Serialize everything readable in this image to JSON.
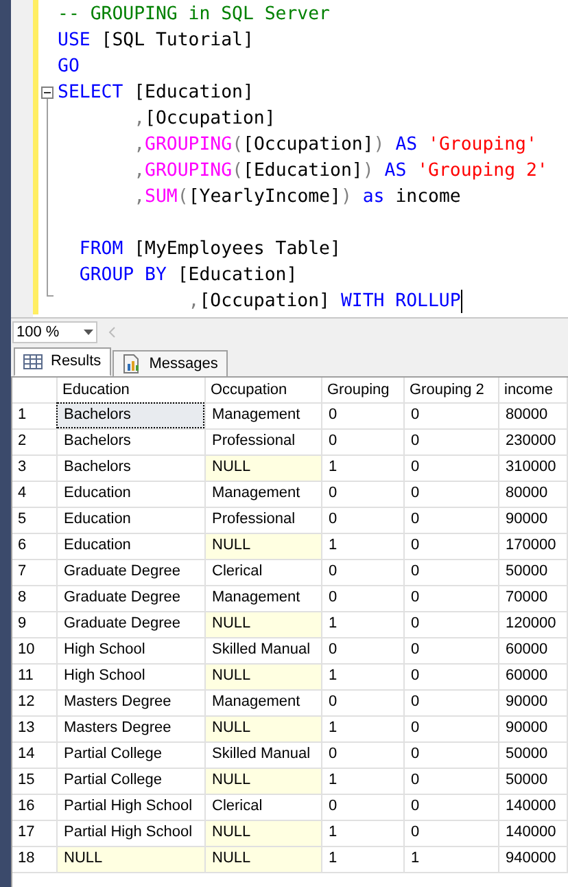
{
  "editor": {
    "lines": [
      {
        "tokens": [
          {
            "kind": "comment",
            "text": "-- GROUPING in SQL Server"
          }
        ]
      },
      {
        "tokens": [
          {
            "kind": "keyword",
            "text": "USE"
          },
          {
            "kind": "plain",
            "text": " [SQL Tutorial]"
          }
        ]
      },
      {
        "tokens": [
          {
            "kind": "keyword",
            "text": "GO"
          }
        ]
      },
      {
        "collapse": true,
        "tokens": [
          {
            "kind": "keyword",
            "text": "SELECT"
          },
          {
            "kind": "plain",
            "text": " [Education]"
          }
        ]
      },
      {
        "tokens": [
          {
            "kind": "operator",
            "text": "       ,"
          },
          {
            "kind": "plain",
            "text": "[Occupation]"
          }
        ]
      },
      {
        "lead": "       ,",
        "tokens": [
          {
            "kind": "function",
            "text": "GROUPING"
          },
          {
            "kind": "operator",
            "text": "("
          },
          {
            "kind": "plain",
            "text": "[Occupation]"
          },
          {
            "kind": "operator",
            "text": ")"
          },
          {
            "kind": "keyword",
            "text": " AS"
          },
          {
            "kind": "string",
            "text": " 'Grouping'"
          }
        ]
      },
      {
        "lead": "       ,",
        "tokens": [
          {
            "kind": "function",
            "text": "GROUPING"
          },
          {
            "kind": "operator",
            "text": "("
          },
          {
            "kind": "plain",
            "text": "[Education]"
          },
          {
            "kind": "operator",
            "text": ")"
          },
          {
            "kind": "keyword",
            "text": " AS"
          },
          {
            "kind": "string",
            "text": " 'Grouping 2'"
          }
        ]
      },
      {
        "tokens": [
          {
            "kind": "operator",
            "text": "       ,"
          },
          {
            "kind": "function",
            "text": "SUM"
          },
          {
            "kind": "operator",
            "text": "("
          },
          {
            "kind": "plain",
            "text": "[YearlyIncome]"
          },
          {
            "kind": "operator",
            "text": ")"
          },
          {
            "kind": "keyword",
            "text": " as"
          },
          {
            "kind": "plain",
            "text": " income"
          }
        ]
      },
      {
        "blank_before": true,
        "tokens": [
          {
            "kind": "keyword",
            "text": "  FROM"
          },
          {
            "kind": "plain",
            "text": " [MyEmployees Table]"
          }
        ]
      },
      {
        "tokens": [
          {
            "kind": "keyword",
            "text": "  GROUP BY"
          },
          {
            "kind": "plain",
            "text": " [Education]"
          }
        ]
      },
      {
        "cursor": true,
        "tokens": [
          {
            "kind": "operator",
            "text": "            ,"
          },
          {
            "kind": "plain",
            "text": "[Occupation]"
          },
          {
            "kind": "keyword",
            "text": " WITH ROLLUP"
          }
        ]
      }
    ]
  },
  "zoom": {
    "value": "100 %"
  },
  "tabs": [
    {
      "label": "Results",
      "selected": true
    },
    {
      "label": "Messages",
      "selected": false
    }
  ],
  "table": {
    "columns": [
      "Education",
      "Occupation",
      "Grouping",
      "Grouping 2",
      "income"
    ],
    "rows": [
      {
        "number": "1",
        "cells": [
          {
            "text": "Bachelors",
            "null": false,
            "selected": true
          },
          {
            "text": "Management",
            "null": false,
            "selected": false
          },
          {
            "text": "0",
            "null": false,
            "selected": false
          },
          {
            "text": "0",
            "null": false,
            "selected": false
          },
          {
            "text": "80000",
            "null": false,
            "selected": false
          }
        ]
      },
      {
        "number": "2",
        "cells": [
          {
            "text": "Bachelors",
            "null": false,
            "selected": false
          },
          {
            "text": "Professional",
            "null": false,
            "selected": false
          },
          {
            "text": "0",
            "null": false,
            "selected": false
          },
          {
            "text": "0",
            "null": false,
            "selected": false
          },
          {
            "text": "230000",
            "null": false,
            "selected": false
          }
        ]
      },
      {
        "number": "3",
        "cells": [
          {
            "text": "Bachelors",
            "null": false,
            "selected": false
          },
          {
            "text": "NULL",
            "null": true,
            "selected": false
          },
          {
            "text": "1",
            "null": false,
            "selected": false
          },
          {
            "text": "0",
            "null": false,
            "selected": false
          },
          {
            "text": "310000",
            "null": false,
            "selected": false
          }
        ]
      },
      {
        "number": "4",
        "cells": [
          {
            "text": "Education",
            "null": false,
            "selected": false
          },
          {
            "text": "Management",
            "null": false,
            "selected": false
          },
          {
            "text": "0",
            "null": false,
            "selected": false
          },
          {
            "text": "0",
            "null": false,
            "selected": false
          },
          {
            "text": "80000",
            "null": false,
            "selected": false
          }
        ]
      },
      {
        "number": "5",
        "cells": [
          {
            "text": "Education",
            "null": false,
            "selected": false
          },
          {
            "text": "Professional",
            "null": false,
            "selected": false
          },
          {
            "text": "0",
            "null": false,
            "selected": false
          },
          {
            "text": "0",
            "null": false,
            "selected": false
          },
          {
            "text": "90000",
            "null": false,
            "selected": false
          }
        ]
      },
      {
        "number": "6",
        "cells": [
          {
            "text": "Education",
            "null": false,
            "selected": false
          },
          {
            "text": "NULL",
            "null": true,
            "selected": false
          },
          {
            "text": "1",
            "null": false,
            "selected": false
          },
          {
            "text": "0",
            "null": false,
            "selected": false
          },
          {
            "text": "170000",
            "null": false,
            "selected": false
          }
        ]
      },
      {
        "number": "7",
        "cells": [
          {
            "text": "Graduate Degree",
            "null": false,
            "selected": false
          },
          {
            "text": "Clerical",
            "null": false,
            "selected": false
          },
          {
            "text": "0",
            "null": false,
            "selected": false
          },
          {
            "text": "0",
            "null": false,
            "selected": false
          },
          {
            "text": "50000",
            "null": false,
            "selected": false
          }
        ]
      },
      {
        "number": "8",
        "cells": [
          {
            "text": "Graduate Degree",
            "null": false,
            "selected": false
          },
          {
            "text": "Management",
            "null": false,
            "selected": false
          },
          {
            "text": "0",
            "null": false,
            "selected": false
          },
          {
            "text": "0",
            "null": false,
            "selected": false
          },
          {
            "text": "70000",
            "null": false,
            "selected": false
          }
        ]
      },
      {
        "number": "9",
        "cells": [
          {
            "text": "Graduate Degree",
            "null": false,
            "selected": false
          },
          {
            "text": "NULL",
            "null": true,
            "selected": false
          },
          {
            "text": "1",
            "null": false,
            "selected": false
          },
          {
            "text": "0",
            "null": false,
            "selected": false
          },
          {
            "text": "120000",
            "null": false,
            "selected": false
          }
        ]
      },
      {
        "number": "10",
        "cells": [
          {
            "text": "High School",
            "null": false,
            "selected": false
          },
          {
            "text": "Skilled Manual",
            "null": false,
            "selected": false
          },
          {
            "text": "0",
            "null": false,
            "selected": false
          },
          {
            "text": "0",
            "null": false,
            "selected": false
          },
          {
            "text": "60000",
            "null": false,
            "selected": false
          }
        ]
      },
      {
        "number": "11",
        "cells": [
          {
            "text": "High School",
            "null": false,
            "selected": false
          },
          {
            "text": "NULL",
            "null": true,
            "selected": false
          },
          {
            "text": "1",
            "null": false,
            "selected": false
          },
          {
            "text": "0",
            "null": false,
            "selected": false
          },
          {
            "text": "60000",
            "null": false,
            "selected": false
          }
        ]
      },
      {
        "number": "12",
        "cells": [
          {
            "text": "Masters Degree",
            "null": false,
            "selected": false
          },
          {
            "text": "Management",
            "null": false,
            "selected": false
          },
          {
            "text": "0",
            "null": false,
            "selected": false
          },
          {
            "text": "0",
            "null": false,
            "selected": false
          },
          {
            "text": "90000",
            "null": false,
            "selected": false
          }
        ]
      },
      {
        "number": "13",
        "cells": [
          {
            "text": "Masters Degree",
            "null": false,
            "selected": false
          },
          {
            "text": "NULL",
            "null": true,
            "selected": false
          },
          {
            "text": "1",
            "null": false,
            "selected": false
          },
          {
            "text": "0",
            "null": false,
            "selected": false
          },
          {
            "text": "90000",
            "null": false,
            "selected": false
          }
        ]
      },
      {
        "number": "14",
        "cells": [
          {
            "text": "Partial College",
            "null": false,
            "selected": false
          },
          {
            "text": "Skilled Manual",
            "null": false,
            "selected": false
          },
          {
            "text": "0",
            "null": false,
            "selected": false
          },
          {
            "text": "0",
            "null": false,
            "selected": false
          },
          {
            "text": "50000",
            "null": false,
            "selected": false
          }
        ]
      },
      {
        "number": "15",
        "cells": [
          {
            "text": "Partial College",
            "null": false,
            "selected": false
          },
          {
            "text": "NULL",
            "null": true,
            "selected": false
          },
          {
            "text": "1",
            "null": false,
            "selected": false
          },
          {
            "text": "0",
            "null": false,
            "selected": false
          },
          {
            "text": "50000",
            "null": false,
            "selected": false
          }
        ]
      },
      {
        "number": "16",
        "cells": [
          {
            "text": "Partial High School",
            "null": false,
            "selected": false
          },
          {
            "text": "Clerical",
            "null": false,
            "selected": false
          },
          {
            "text": "0",
            "null": false,
            "selected": false
          },
          {
            "text": "0",
            "null": false,
            "selected": false
          },
          {
            "text": "140000",
            "null": false,
            "selected": false
          }
        ]
      },
      {
        "number": "17",
        "cells": [
          {
            "text": "Partial High School",
            "null": false,
            "selected": false
          },
          {
            "text": "NULL",
            "null": true,
            "selected": false
          },
          {
            "text": "1",
            "null": false,
            "selected": false
          },
          {
            "text": "0",
            "null": false,
            "selected": false
          },
          {
            "text": "140000",
            "null": false,
            "selected": false
          }
        ]
      },
      {
        "number": "18",
        "cells": [
          {
            "text": "NULL",
            "null": true,
            "selected": false
          },
          {
            "text": "NULL",
            "null": true,
            "selected": false
          },
          {
            "text": "1",
            "null": false,
            "selected": false
          },
          {
            "text": "1",
            "null": false,
            "selected": false
          },
          {
            "text": "940000",
            "null": false,
            "selected": false
          }
        ]
      }
    ]
  }
}
